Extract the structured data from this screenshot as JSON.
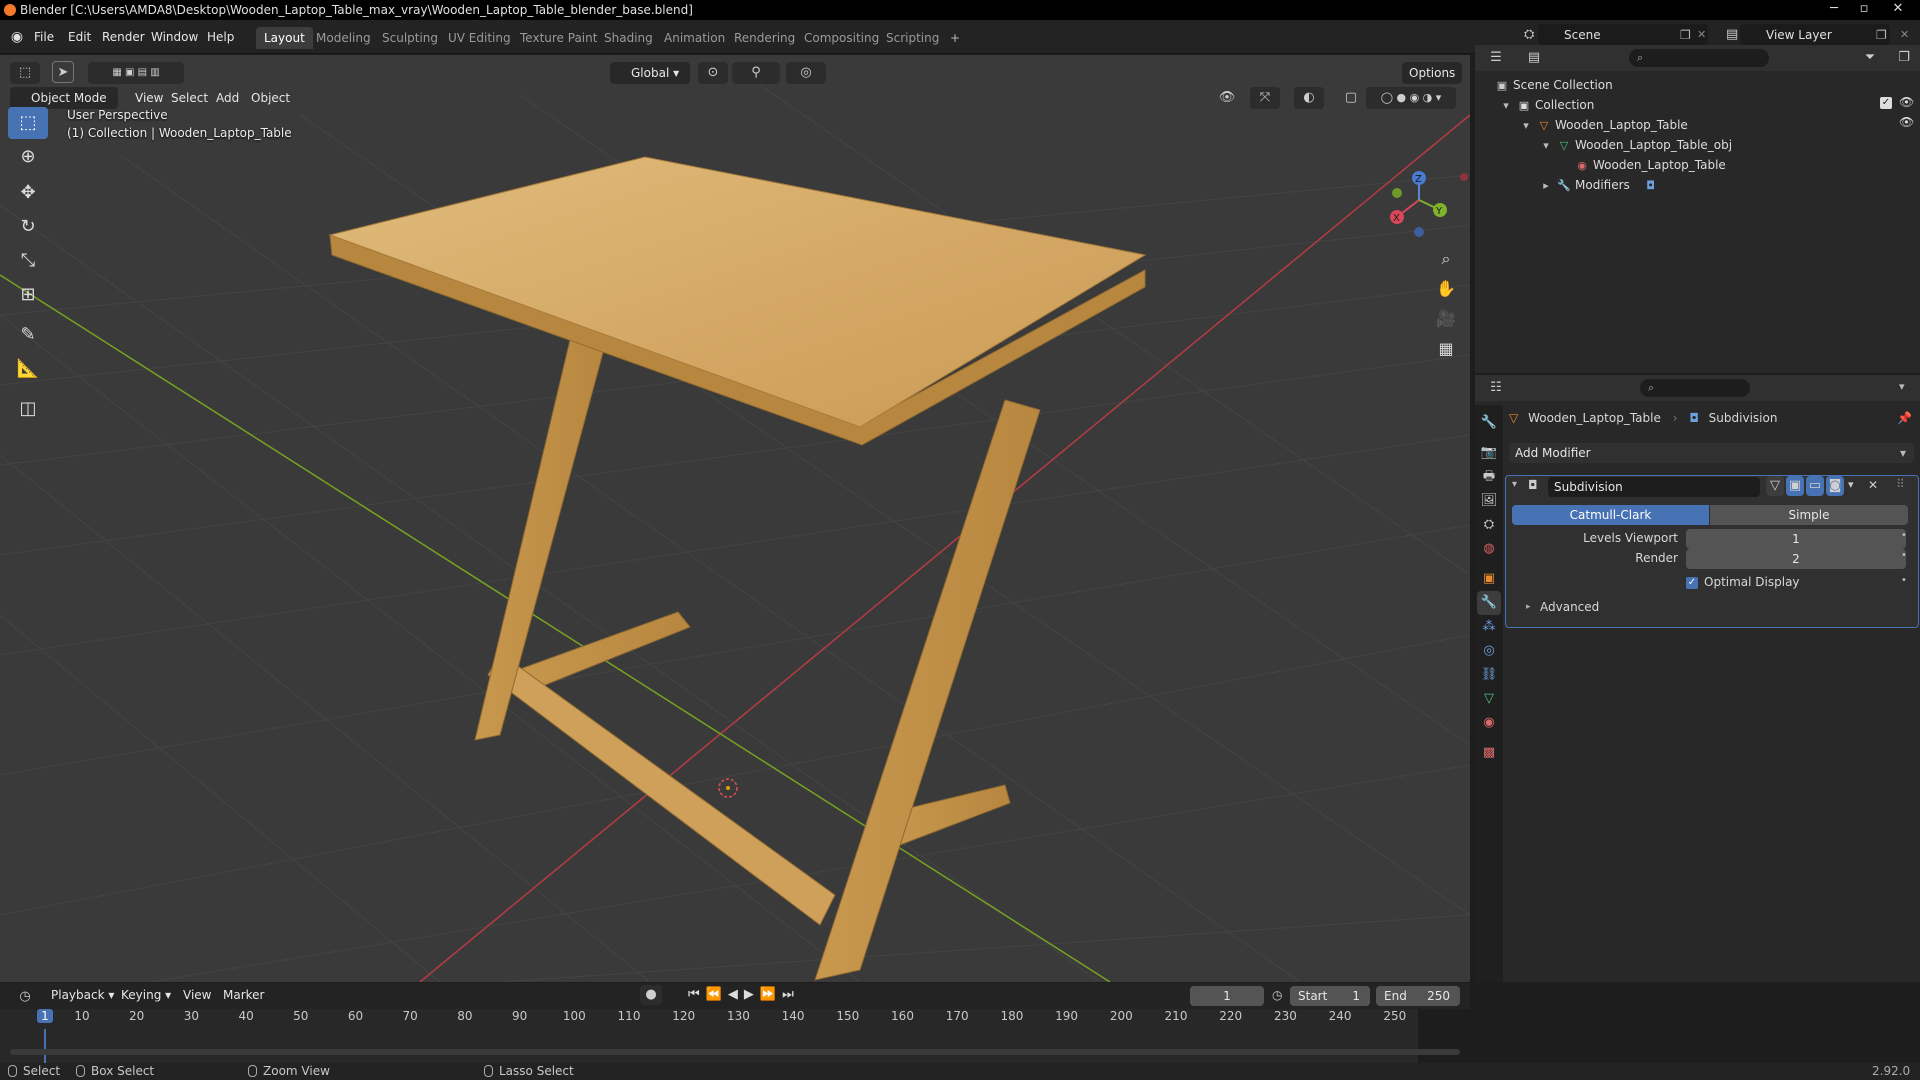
{
  "window": {
    "title": "Blender [C:\\Users\\AMDA8\\Desktop\\Wooden_Laptop_Table_max_vray\\Wooden_Laptop_Table_blender_base.blend]",
    "minimize": "─",
    "maximize": "▫",
    "close": "✕"
  },
  "menubar": {
    "items": [
      "File",
      "Edit",
      "Render",
      "Window",
      "Help"
    ]
  },
  "workspaces": {
    "tabs": [
      "Layout",
      "Modeling",
      "Sculpting",
      "UV Editing",
      "Texture Paint",
      "Shading",
      "Animation",
      "Rendering",
      "Compositing",
      "Scripting"
    ],
    "active": "Layout",
    "add": "+"
  },
  "scene": {
    "name": "Scene",
    "view_layer": "View Layer"
  },
  "viewport": {
    "mode": "Object Mode",
    "menus": [
      "View",
      "Select",
      "Add",
      "Object"
    ],
    "transform_orientation": "Global",
    "options": "Options",
    "perspective_label": "User Perspective",
    "collection_label": "(1) Collection | Wooden_Laptop_Table",
    "gizmo": {
      "x": "X",
      "y": "Y",
      "z": "Z"
    }
  },
  "outliner": {
    "rows": [
      {
        "label": "Scene Collection",
        "icon": "scene-collection-icon"
      },
      {
        "label": "Collection",
        "icon": "collection-icon"
      },
      {
        "label": "Wooden_Laptop_Table",
        "icon": "object-icon"
      },
      {
        "label": "Wooden_Laptop_Table_obj",
        "icon": "mesh-icon"
      },
      {
        "label": "Wooden_Laptop_Table",
        "icon": "material-icon"
      },
      {
        "label": "Modifiers",
        "icon": "wrench-icon"
      }
    ]
  },
  "properties": {
    "breadcrumb_object": "Wooden_Laptop_Table",
    "breadcrumb_modifier": "Subdivision",
    "add_modifier": "Add Modifier",
    "modifier": {
      "name": "Subdivision",
      "type_options": [
        "Catmull-Clark",
        "Simple"
      ],
      "type_selected": "Catmull-Clark",
      "levels_viewport_label": "Levels Viewport",
      "levels_viewport": "1",
      "render_label": "Render",
      "render": "2",
      "optimal_display_label": "Optimal Display",
      "optimal_display": true,
      "advanced": "Advanced"
    }
  },
  "timeline": {
    "menus": [
      "Playback",
      "Keying",
      "View",
      "Marker"
    ],
    "current_frame": "1",
    "start_label": "Start",
    "start": "1",
    "end_label": "End",
    "end": "250",
    "ticks": [
      "1",
      "10",
      "20",
      "30",
      "40",
      "50",
      "60",
      "70",
      "80",
      "90",
      "100",
      "110",
      "120",
      "130",
      "140",
      "150",
      "160",
      "170",
      "180",
      "190",
      "200",
      "210",
      "220",
      "230",
      "240",
      "250"
    ]
  },
  "statusbar": {
    "select": "Select",
    "box_select": "Box Select",
    "zoom_view": "Zoom View",
    "lasso_select": "Lasso Select",
    "version": "2.92.0"
  },
  "colors": {
    "accent": "#4772b3",
    "viewport_bg": "#3a3a3a",
    "grid_x_axis": "#b83a45",
    "grid_y_axis": "#77a320",
    "wood": "#d3a864"
  }
}
